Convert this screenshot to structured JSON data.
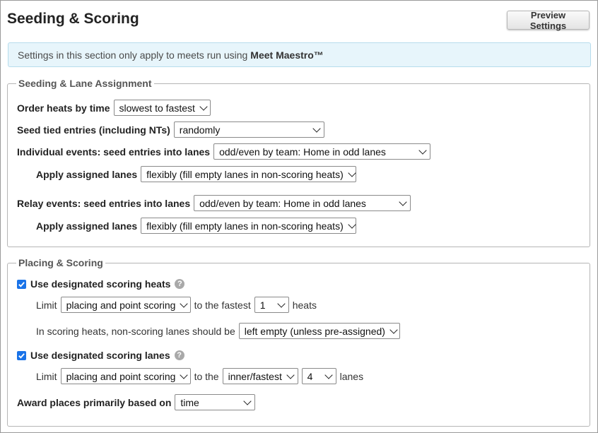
{
  "header": {
    "title": "Seeding & Scoring",
    "preview_button": "Preview Settings"
  },
  "info": {
    "text": "Settings in this section only apply to meets run using",
    "product": "Meet Maestro™"
  },
  "seeding": {
    "legend": "Seeding & Lane Assignment",
    "order_heats_label": "Order heats by time",
    "order_heats_value": "slowest to fastest",
    "tied_label": "Seed tied entries (including NTs)",
    "tied_value": "randomly",
    "individual_label": "Individual events: seed entries into lanes",
    "individual_value": "odd/even by team: Home in odd lanes",
    "individual_apply_label": "Apply assigned lanes",
    "individual_apply_value": "flexibly (fill empty lanes in non-scoring heats)",
    "relay_label": "Relay events: seed entries into lanes",
    "relay_value": "odd/even by team: Home in odd lanes",
    "relay_apply_label": "Apply assigned lanes",
    "relay_apply_value": "flexibly (fill empty lanes in non-scoring heats)"
  },
  "scoring": {
    "legend": "Placing & Scoring",
    "heats_checkbox_label": "Use designated scoring heats",
    "heats_checked": true,
    "heats_limit": "Limit",
    "heats_limit_value": "placing and point scoring",
    "heats_to_fastest": "to the fastest",
    "heats_count": "1",
    "heats_unit": "heats",
    "nonscoring_label": "In scoring heats, non-scoring lanes should be",
    "nonscoring_value": "left empty (unless pre-assigned)",
    "lanes_checkbox_label": "Use designated scoring lanes",
    "lanes_checked": true,
    "lanes_limit": "Limit",
    "lanes_limit_value": "placing and point scoring",
    "lanes_to_the": "to the",
    "lanes_which": "inner/fastest",
    "lanes_count": "4",
    "lanes_unit": "lanes",
    "award_label": "Award places primarily based on",
    "award_value": "time"
  }
}
